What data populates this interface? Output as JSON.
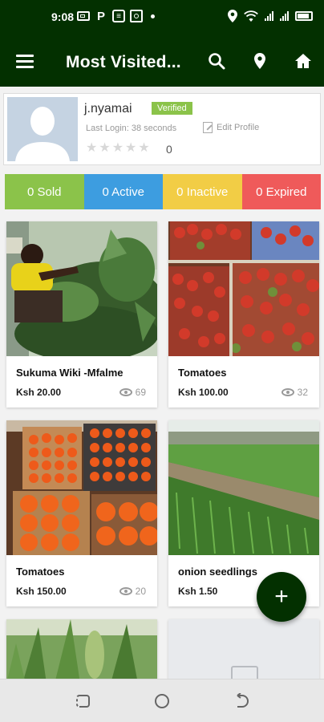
{
  "status_bar": {
    "time": "9:08",
    "icons": [
      "screen-recorder-icon",
      "parking-icon",
      "message-icon",
      "camera-icon",
      "location-icon",
      "wifi-icon",
      "signal-icon",
      "battery-icon"
    ]
  },
  "app_bar": {
    "title": "Most Visited...",
    "icons": [
      "menu-icon",
      "search-icon",
      "location-pin-icon",
      "home-icon"
    ]
  },
  "profile": {
    "username": "j.nyamai",
    "badge": "Verified",
    "last_login": "Last Login: 38 seconds",
    "edit_label": "Edit Profile",
    "rating_count": "0",
    "stars": 5
  },
  "stats": [
    {
      "label": "0 Sold",
      "color": "#8bc34a"
    },
    {
      "label": "0 Active",
      "color": "#3d9de0"
    },
    {
      "label": "0 Inactive",
      "color": "#f2cd45"
    },
    {
      "label": "0 Expired",
      "color": "#ef5a5a"
    }
  ],
  "listings": [
    {
      "title": "Sukuma Wiki -Mfalme",
      "price": "Ksh 20.00",
      "views": "69"
    },
    {
      "title": "Tomatoes",
      "price": "Ksh 100.00",
      "views": "32"
    },
    {
      "title": "Tomatoes",
      "price": "Ksh 150.00",
      "views": "20"
    },
    {
      "title": "onion seedlings",
      "price": "Ksh 1.50",
      "views": ""
    }
  ],
  "fab": {
    "label": "+"
  },
  "colors": {
    "primary": "#033000"
  }
}
